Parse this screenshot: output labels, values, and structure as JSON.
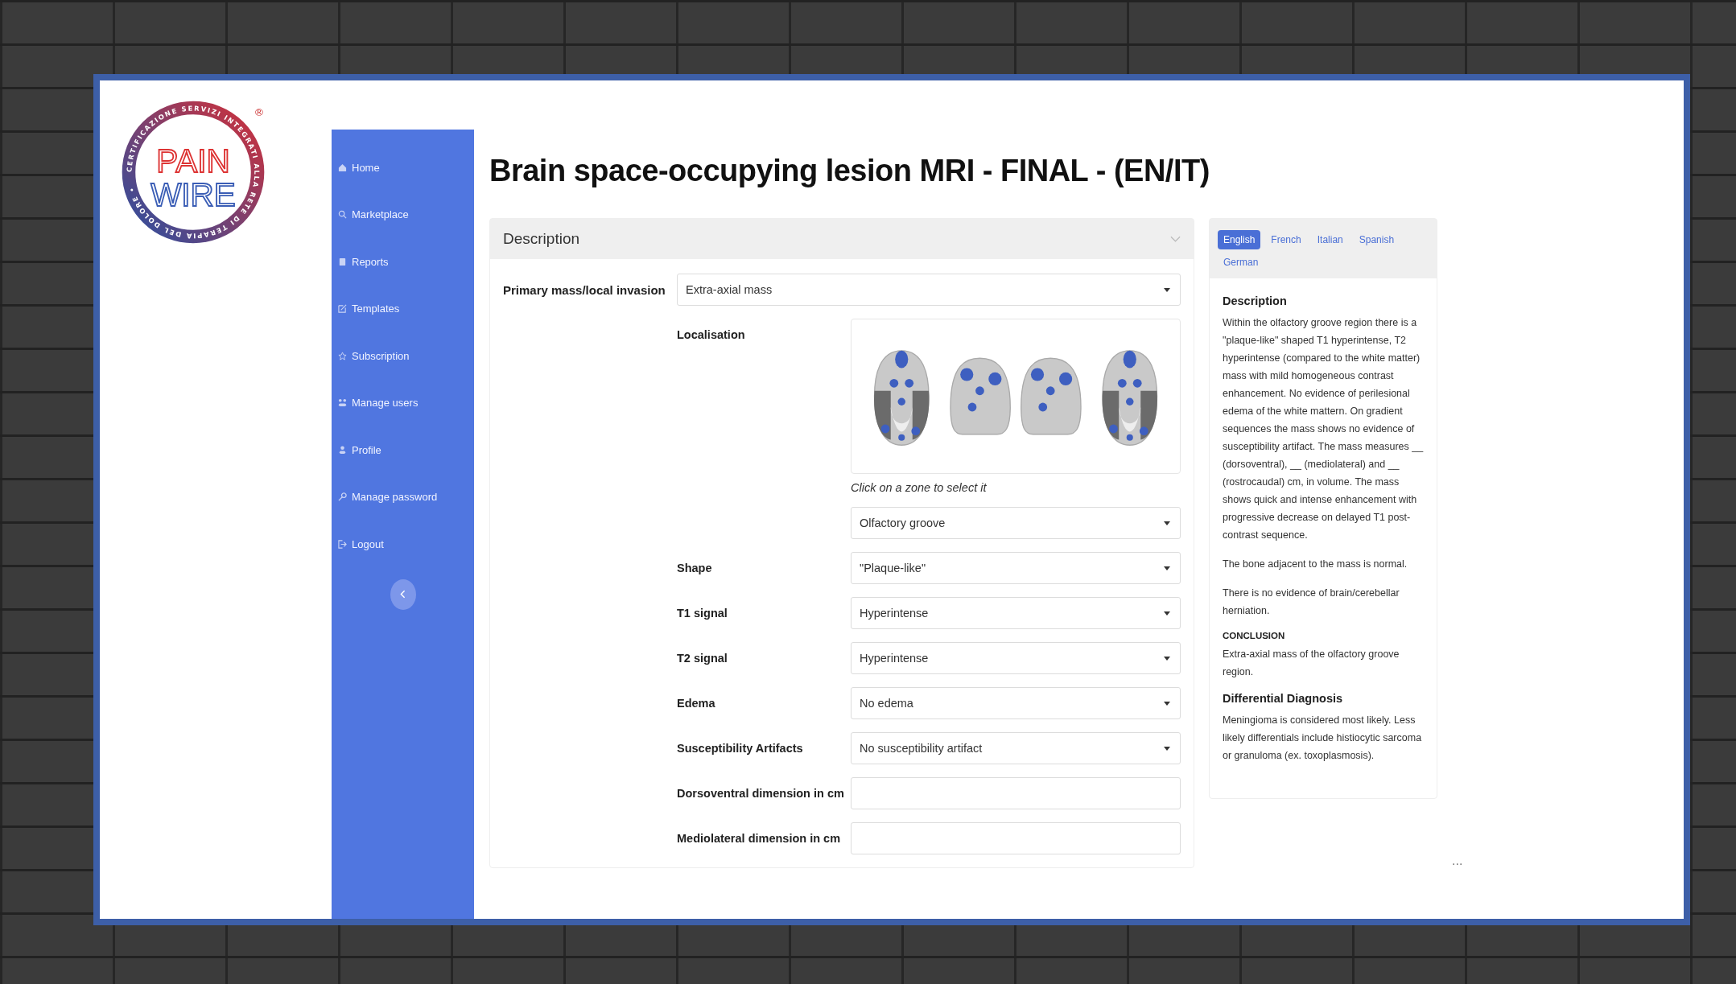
{
  "logo": {
    "ring_text": "CERTIFICAZIONE SERVIZI INTEGRATI ALLA RETE DI TERAPIA DEL DOLORE •",
    "line_1": "PAIN",
    "line_2": "WIRE",
    "mark": "®"
  },
  "sidebar": {
    "items": [
      {
        "label": "Home",
        "kind": "home"
      },
      {
        "label": "Marketplace",
        "kind": "search"
      },
      {
        "label": "Reports",
        "kind": "clipboard"
      },
      {
        "label": "Templates",
        "kind": "edit"
      },
      {
        "label": "Subscription",
        "kind": "star"
      },
      {
        "label": "Manage users",
        "kind": "users"
      },
      {
        "label": "Profile",
        "kind": "person"
      },
      {
        "label": "Manage password",
        "kind": "key"
      },
      {
        "label": "Logout",
        "kind": "logout"
      }
    ]
  },
  "page_title": "Brain space-occupying lesion MRI - FINAL - (EN/IT)",
  "description_card": {
    "title": "Description",
    "primary": {
      "label": "Primary mass/local invasion",
      "value": "Extra-axial mass"
    },
    "localisation": {
      "label": "Localisation",
      "hint": "Click on a zone to select it",
      "value": "Olfactory groove"
    },
    "fields": [
      {
        "label": "Shape",
        "kind": "select",
        "value": "\"Plaque-like\""
      },
      {
        "label": "T1 signal",
        "kind": "select",
        "value": "Hyperintense"
      },
      {
        "label": "T2 signal",
        "kind": "select",
        "value": "Hyperintense"
      },
      {
        "label": "Edema",
        "kind": "select",
        "value": "No edema"
      },
      {
        "label": "Susceptibility Artifacts",
        "kind": "select",
        "value": "No susceptibility artifact"
      },
      {
        "label": "Dorsoventral dimension in cm",
        "kind": "text"
      },
      {
        "label": "Mediolateral dimension in cm",
        "kind": "text"
      }
    ]
  },
  "report_panel": {
    "languages": [
      {
        "label": "English",
        "selected": true
      },
      {
        "label": "French",
        "selected": false
      },
      {
        "label": "Italian",
        "selected": false
      },
      {
        "label": "Spanish",
        "selected": false
      },
      {
        "label": "German",
        "selected": false
      }
    ],
    "blocks": [
      {
        "kind": "heading",
        "text": "Description"
      },
      {
        "kind": "paragraph",
        "text": "Within the olfactory groove region there is a \"plaque-like\" shaped T1 hyperintense, T2 hyperintense (compared to the white matter) mass with mild homogeneous contrast enhancement. No evidence of perilesional edema of the white mattern. On gradient sequences the mass shows no evidence of susceptibility artifact. The mass measures __ (dorsoventral), __ (mediolateral) and __ (rostrocaudal) cm, in volume. The mass shows quick and intense enhancement with progressive decrease on delayed T1 post-contrast sequence."
      },
      {
        "kind": "paragraph",
        "text": "The bone adjacent to the mass is normal."
      },
      {
        "kind": "paragraph",
        "text": "There is no evidence of brain/cerebellar herniation."
      },
      {
        "kind": "subheading",
        "text": "CONCLUSION"
      },
      {
        "kind": "paragraph",
        "text": "Extra-axial mass of the olfactory groove region."
      },
      {
        "kind": "heading",
        "text": "Differential Diagnosis"
      },
      {
        "kind": "paragraph",
        "text": "Meningioma is considered most likely. Less likely differentials include histiocytic sarcoma or granuloma (ex. toxoplasmosis)."
      }
    ]
  },
  "more_text": "..."
}
